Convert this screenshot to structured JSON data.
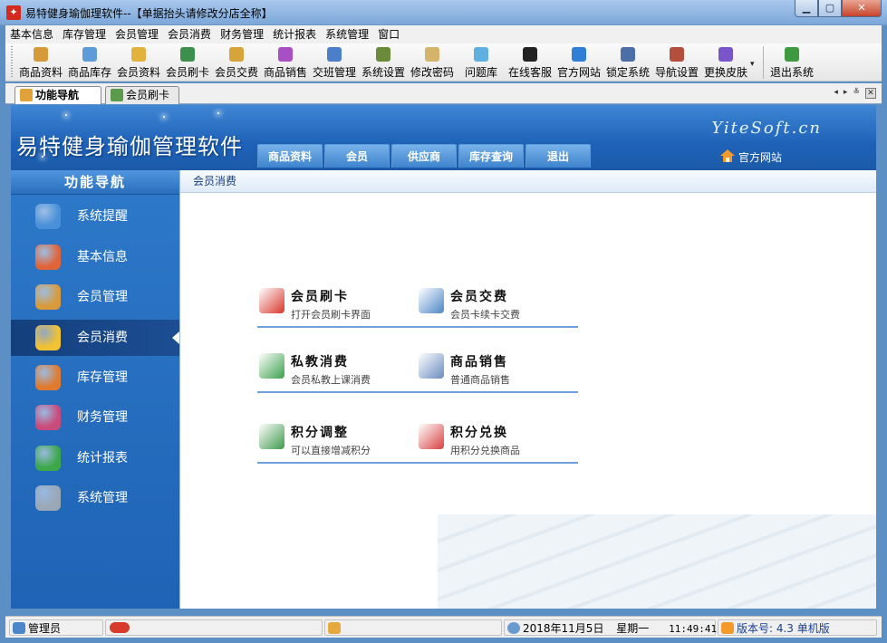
{
  "window": {
    "title": "易特健身瑜伽理软件--【单据抬头请修改分店全称】",
    "icon": "app-logo-icon"
  },
  "menu": [
    "基本信息",
    "库存管理",
    "会员管理",
    "会员消费",
    "财务管理",
    "统计报表",
    "系统管理",
    "窗口"
  ],
  "toolbar": [
    {
      "label": "商品资料",
      "icon": "product-data-icon",
      "color": "#d59b3b"
    },
    {
      "label": "商品库存",
      "icon": "product-stock-icon",
      "color": "#5d9cd8"
    },
    {
      "label": "会员资料",
      "icon": "member-data-icon",
      "color": "#e3b23c"
    },
    {
      "label": "会员刷卡",
      "icon": "member-card-icon",
      "color": "#3c8f4d"
    },
    {
      "label": "会员交费",
      "icon": "member-payment-icon",
      "color": "#d6a43a"
    },
    {
      "label": "商品销售",
      "icon": "product-sales-icon",
      "color": "#a94fc4"
    },
    {
      "label": "交班管理",
      "icon": "shift-manage-icon",
      "color": "#4c7fc9"
    },
    {
      "label": "系统设置",
      "icon": "system-settings-icon",
      "color": "#6b8a3a"
    },
    {
      "label": "修改密码",
      "icon": "change-password-icon",
      "color": "#d3b46a"
    },
    {
      "label": "问题库",
      "icon": "faq-icon",
      "color": "#5db0e0"
    },
    {
      "label": "在线客服",
      "icon": "online-service-icon",
      "color": "#222222"
    },
    {
      "label": "官方网站",
      "icon": "ie-browser-icon",
      "color": "#2f7fd6"
    },
    {
      "label": "锁定系统",
      "icon": "lock-system-icon",
      "color": "#4c6fa8"
    },
    {
      "label": "导航设置",
      "icon": "nav-settings-icon",
      "color": "#b44e3d"
    },
    {
      "label": "更换皮肤",
      "icon": "change-skin-icon",
      "color": "#7a55c9"
    },
    {
      "label": "退出系统",
      "icon": "exit-system-icon",
      "color": "#3f9a3f"
    }
  ],
  "tabs": [
    {
      "label": "功能导航",
      "icon": "home-nav-icon",
      "active": true
    },
    {
      "label": "会员刷卡",
      "icon": "member-card-tab-icon",
      "active": false
    }
  ],
  "tab_controls": {
    "left": "◂",
    "right": "▸",
    "menu": "≚",
    "close": "✕"
  },
  "banner": {
    "app_name": "易特健身瑜伽管理软件",
    "brand": "YiteSoft.cn",
    "site_link": "官方网站",
    "quick_buttons": [
      "商品资料",
      "会员",
      "供应商",
      "库存查询",
      "退出"
    ]
  },
  "nav": {
    "header": "功能导航",
    "items": [
      {
        "label": "系统提醒",
        "icon": "info-icon",
        "color": "#4a90d9",
        "active": false
      },
      {
        "label": "基本信息",
        "icon": "cubes-icon",
        "color": "#e0643a",
        "active": false
      },
      {
        "label": "会员管理",
        "icon": "member-box-icon",
        "color": "#d89a3a",
        "active": false
      },
      {
        "label": "会员消费",
        "icon": "chat-bubbles-icon",
        "color": "#f1c232",
        "active": true
      },
      {
        "label": "库存管理",
        "icon": "warehouse-icon",
        "color": "#e07a2f",
        "active": false
      },
      {
        "label": "财务管理",
        "icon": "finance-icon",
        "color": "#c94b7a",
        "active": false
      },
      {
        "label": "统计报表",
        "icon": "bar-chart-icon",
        "color": "#3da84a",
        "active": false
      },
      {
        "label": "系统管理",
        "icon": "tools-icon",
        "color": "#9aa7b5",
        "active": false
      }
    ]
  },
  "main": {
    "header": "会员消费",
    "functions": [
      {
        "title": "会员刷卡",
        "desc": "打开会员刷卡界面",
        "icon": "card-swipe-icon",
        "color": "#d8362b"
      },
      {
        "title": "会员交费",
        "desc": "会员卡续卡交费",
        "icon": "payment-form-icon",
        "color": "#4c86c6"
      },
      {
        "title": "私教消费",
        "desc": "会员私教上课消费",
        "icon": "numbers-123-icon",
        "color": "#3aa04a"
      },
      {
        "title": "商品销售",
        "desc": "普通商品销售",
        "icon": "pos-register-icon",
        "color": "#6a8cc0"
      },
      {
        "title": "积分调整",
        "desc": "可以直接增减积分",
        "icon": "user-plus-icon",
        "color": "#3e9a4a"
      },
      {
        "title": "积分兑换",
        "desc": "用积分兑换商品",
        "icon": "gift-box-icon",
        "color": "#d94040"
      }
    ]
  },
  "status": {
    "user": "管理员",
    "date": "2018年11月5日",
    "weekday": "星期一",
    "time": "11:49:41",
    "version": "版本号: 4.3 单机版"
  }
}
